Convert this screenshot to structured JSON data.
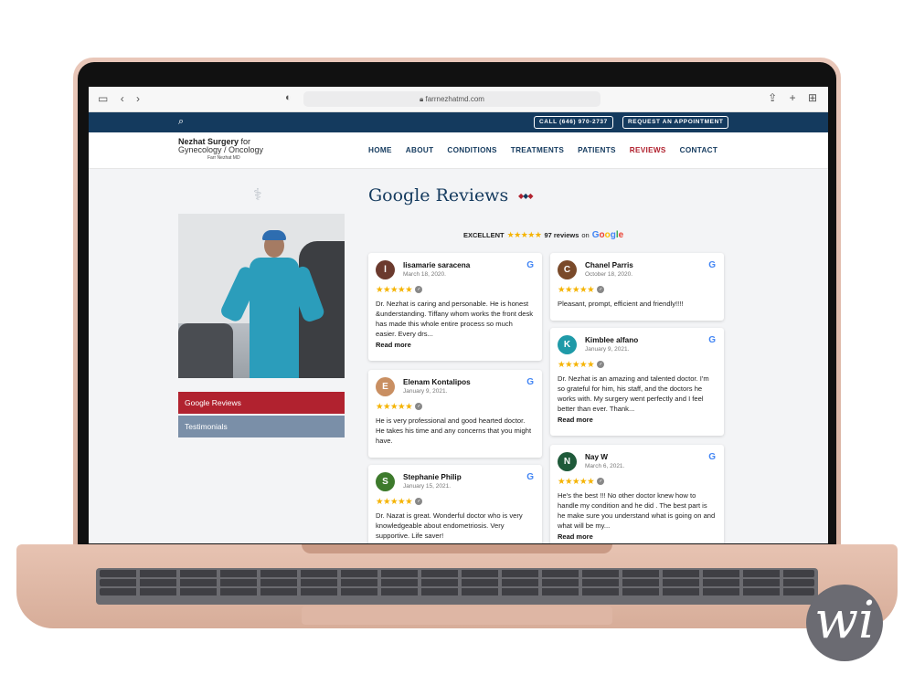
{
  "browser": {
    "url": "farrnezhatmd.com"
  },
  "topbar": {
    "call_label": "CALL (646) 970-2737",
    "appointment_label": "REQUEST AN APPOINTMENT"
  },
  "logo": {
    "line1_bold": "Nezhat Surgery",
    "line1_rest": " for",
    "line2": "Gynecology / Oncology",
    "line3": "Farr Nezhat MD"
  },
  "nav": {
    "items": [
      "HOME",
      "ABOUT",
      "CONDITIONS",
      "TREATMENTS",
      "PATIENTS",
      "REVIEWS",
      "CONTACT"
    ],
    "active_index": 5
  },
  "sidebar": {
    "google_reviews": "Google Reviews",
    "testimonials": "Testimonials"
  },
  "main": {
    "title": "Google Reviews",
    "summary": {
      "rating_label": "EXCELLENT",
      "stars": "★★★★★",
      "count": "97 reviews",
      "on": "on"
    }
  },
  "reviews": [
    {
      "name": "lisamarie saracena",
      "date": "March 18, 2020.",
      "initial": "l",
      "avatar_color": "#6b3a2e",
      "stars": "★★★★★",
      "text": "Dr. Nezhat is caring and personable. He is honest &understanding. Tiffany whom works the front desk has made this whole entire process so much easier. Every drs...",
      "more": "Read more"
    },
    {
      "name": "Elenam Kontalipos",
      "date": "January 9, 2021.",
      "initial": "E",
      "avatar_color": "#c98f62",
      "stars": "★★★★★",
      "text": "He is very professional and good hearted doctor. He takes his time and any concerns that you might have.",
      "more": ""
    },
    {
      "name": "Stephanie Philip",
      "date": "January 15, 2021.",
      "initial": "S",
      "avatar_color": "#3d7a2c",
      "stars": "★★★★★",
      "text": "Dr. Nazat is great. Wonderful doctor who is very knowledgeable about endometriosis. Very supportive. Life saver!",
      "more": ""
    },
    {
      "name": "Chanel Parris",
      "date": "October 18, 2020.",
      "initial": "C",
      "avatar_color": "#7a4a2a",
      "stars": "★★★★★",
      "text": "Pleasant, prompt, efficient and friendly!!!!",
      "more": ""
    },
    {
      "name": "Kimblee alfano",
      "date": "January 9, 2021.",
      "initial": "K",
      "avatar_color": "#1f9aa8",
      "stars": "★★★★★",
      "text": "Dr. Nezhat is an amazing and talented doctor. I'm so grateful for him, his staff, and the doctors he works with. My surgery went perfectly and I feel better than ever. Thank...",
      "more": "Read more"
    },
    {
      "name": "Nay W",
      "date": "March 6, 2021.",
      "initial": "N",
      "avatar_color": "#1f5a3a",
      "stars": "★★★★★",
      "text": "He's the best !!! No other doctor knew how to handle my condition and he did . The best part is he make sure you understand what is going on and what will be my...",
      "more": "Read more"
    }
  ],
  "brand_colors": {
    "navy": "#143a5e",
    "red": "#b1222f",
    "grey_blue": "#7a8fa8",
    "star": "#f5b301"
  }
}
